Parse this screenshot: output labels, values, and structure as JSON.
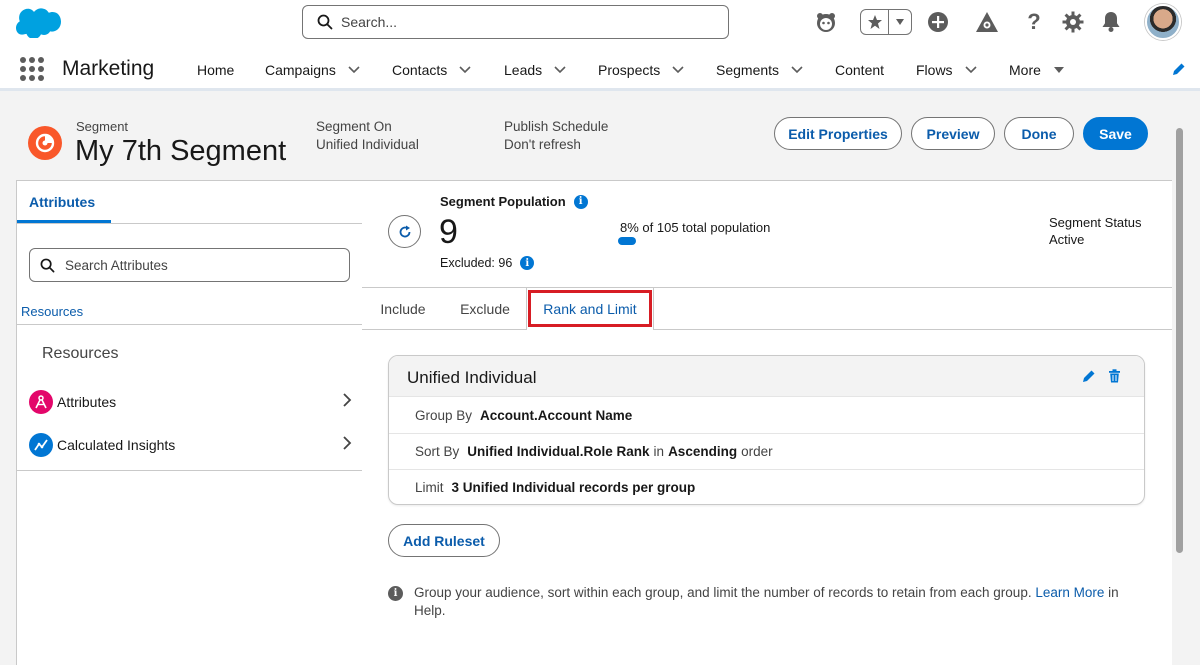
{
  "header": {
    "search_placeholder": "Search...",
    "icons": [
      "salesforce-logo",
      "einstein-icon",
      "favorites-star-icon",
      "favorites-dropdown-icon",
      "add-icon",
      "trailhead-icon",
      "help-icon",
      "setup-gear-icon",
      "notifications-bell-icon",
      "user-avatar"
    ]
  },
  "nav": {
    "app_name": "Marketing",
    "items": [
      {
        "label": "Home"
      },
      {
        "label": "Campaigns"
      },
      {
        "label": "Contacts"
      },
      {
        "label": "Leads"
      },
      {
        "label": "Prospects"
      },
      {
        "label": "Segments"
      },
      {
        "label": "Content"
      },
      {
        "label": "Flows"
      },
      {
        "label": "More"
      }
    ]
  },
  "page_header": {
    "object_label": "Segment",
    "title": "My 7th Segment",
    "segment_on_label": "Segment On",
    "segment_on_value": "Unified Individual",
    "publish_label": "Publish Schedule",
    "publish_value": "Don't refresh",
    "buttons": {
      "edit_properties": "Edit Properties",
      "preview": "Preview",
      "done": "Done",
      "save": "Save"
    }
  },
  "left_panel": {
    "tab_label": "Attributes",
    "search_placeholder": "Search Attributes",
    "resources_link": "Resources",
    "resources_heading": "Resources",
    "items": [
      {
        "label": "Attributes",
        "icon": "attributes-icon",
        "color": "#e3066a"
      },
      {
        "label": "Calculated Insights",
        "icon": "calculated-insights-icon",
        "color": "#0176d3"
      }
    ]
  },
  "population": {
    "label": "Segment Population",
    "count": "9",
    "excluded": "Excluded: 96",
    "percent_text": "8% of 105 total population",
    "percent": 8,
    "status_label": "Segment Status",
    "status_value": "Active"
  },
  "tabs": [
    {
      "label": "Include"
    },
    {
      "label": "Exclude"
    },
    {
      "label": "Rank and Limit",
      "active": true
    }
  ],
  "rank_card": {
    "title": "Unified Individual",
    "group_by_label": "Group By",
    "group_by_value": "Account.Account Name",
    "sort_by_label": "Sort By",
    "sort_by_value": "Unified Individual.Role Rank",
    "sort_in": "in",
    "sort_order": "Ascending",
    "sort_suffix": "order",
    "limit_label": "Limit",
    "limit_value": "3 Unified Individual records per group"
  },
  "add_ruleset": "Add Ruleset",
  "help": {
    "text": "Group your audience, sort within each group, and limit the number of records to retain from each group.",
    "link": "Learn More",
    "suffix": "in Help."
  },
  "colors": {
    "brand": "#0176d3",
    "highlight": "#d71d24",
    "segment_icon": "#f9572a"
  }
}
